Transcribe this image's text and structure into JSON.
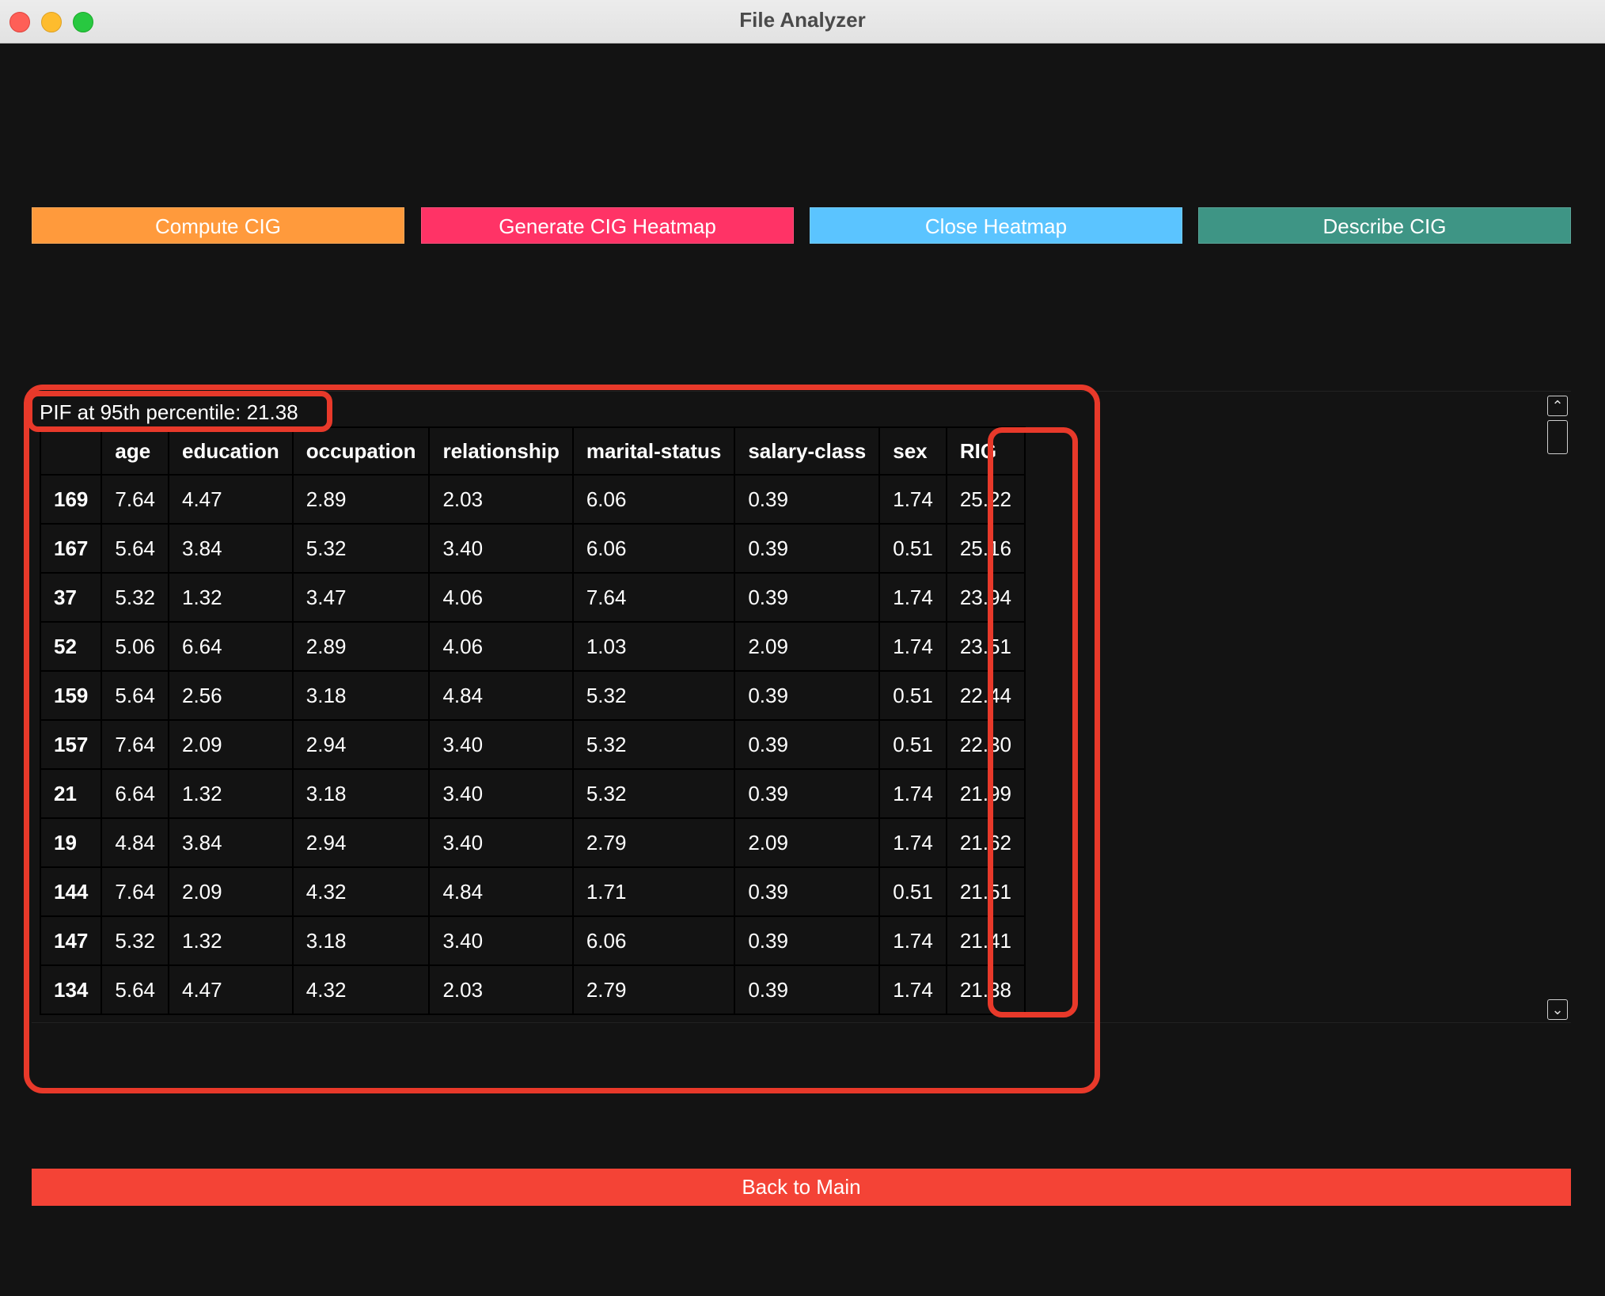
{
  "window": {
    "title": "File Analyzer"
  },
  "toolbar": {
    "compute_label": "Compute CIG",
    "heatmap_label": "Generate CIG Heatmap",
    "close_label": "Close Heatmap",
    "describe_label": "Describe CIG",
    "colors": {
      "compute": "#ff9a3c",
      "heatmap": "#ff3366",
      "close": "#5bc4ff",
      "describe": "#3e9585"
    }
  },
  "results": {
    "pif_text": "PIF at 95th percentile: 21.38",
    "columns": [
      "",
      "age",
      "education",
      "occupation",
      "relationship",
      "marital-status",
      "salary-class",
      "sex",
      "RIG"
    ],
    "rows": [
      [
        "169",
        "7.64",
        "4.47",
        "2.89",
        "2.03",
        "6.06",
        "0.39",
        "1.74",
        "25.22"
      ],
      [
        "167",
        "5.64",
        "3.84",
        "5.32",
        "3.40",
        "6.06",
        "0.39",
        "0.51",
        "25.16"
      ],
      [
        "37",
        "5.32",
        "1.32",
        "3.47",
        "4.06",
        "7.64",
        "0.39",
        "1.74",
        "23.94"
      ],
      [
        "52",
        "5.06",
        "6.64",
        "2.89",
        "4.06",
        "1.03",
        "2.09",
        "1.74",
        "23.51"
      ],
      [
        "159",
        "5.64",
        "2.56",
        "3.18",
        "4.84",
        "5.32",
        "0.39",
        "0.51",
        "22.44"
      ],
      [
        "157",
        "7.64",
        "2.09",
        "2.94",
        "3.40",
        "5.32",
        "0.39",
        "0.51",
        "22.30"
      ],
      [
        "21",
        "6.64",
        "1.32",
        "3.18",
        "3.40",
        "5.32",
        "0.39",
        "1.74",
        "21.99"
      ],
      [
        "19",
        "4.84",
        "3.84",
        "2.94",
        "3.40",
        "2.79",
        "2.09",
        "1.74",
        "21.62"
      ],
      [
        "144",
        "7.64",
        "2.09",
        "4.32",
        "4.84",
        "1.71",
        "0.39",
        "0.51",
        "21.51"
      ],
      [
        "147",
        "5.32",
        "1.32",
        "3.18",
        "3.40",
        "6.06",
        "0.39",
        "1.74",
        "21.41"
      ],
      [
        "134",
        "5.64",
        "4.47",
        "4.32",
        "2.03",
        "2.79",
        "0.39",
        "1.74",
        "21.38"
      ]
    ]
  },
  "footer": {
    "back_label": "Back to Main",
    "color": "#f44336"
  },
  "scrollbar": {
    "up_icon": "chevron-up-icon",
    "down_icon": "chevron-down-icon"
  },
  "annotation": {
    "color": "#e8392a"
  }
}
